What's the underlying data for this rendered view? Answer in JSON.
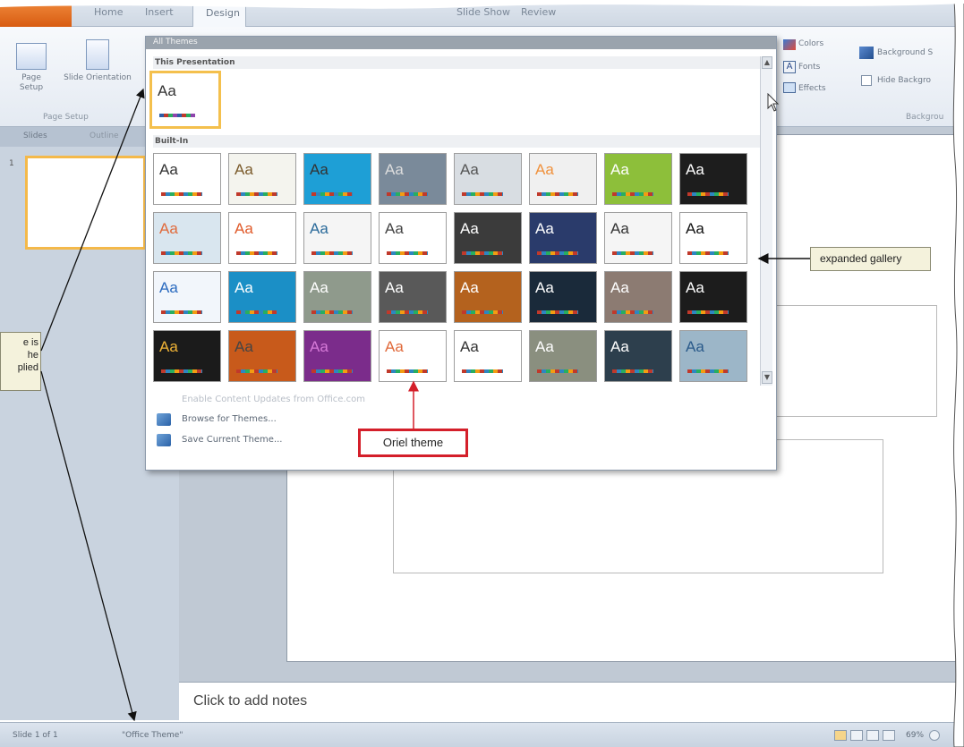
{
  "ribbon": {
    "tabs": [
      "Home",
      "Insert",
      "Design",
      "Slide Show",
      "Review"
    ],
    "page_setup_label": "Page Setup",
    "slide_orientation_label": "Slide Orientation",
    "group_page_setup": "Page Setup",
    "colors_label": "Colors",
    "fonts_label": "Fonts",
    "effects_label": "Effects",
    "background_styles_label": "Background S",
    "hide_background_label": "Hide Backgro",
    "group_background": "Backgrou"
  },
  "left_pane": {
    "tab_slides": "Slides",
    "tab_outline": "Outline",
    "slide_number": "1"
  },
  "gallery": {
    "header": "All Themes",
    "section_this_presentation": "This Presentation",
    "section_built_in": "Built-In",
    "current_theme_aa": "Aa",
    "theme_aa": "Aa",
    "theme_colors": [
      "#ffffff",
      "#f4f4ee",
      "#1e9fd6",
      "#7a8a9a",
      "#d8dde2",
      "#f0f0f0",
      "#8dbf3a",
      "#1d1d1d",
      "#d9e6ef",
      "#ffffff",
      "#f5f5f5",
      "#ffffff",
      "#3b3b3b",
      "#2a3b6b",
      "#f5f5f5",
      "#ffffff",
      "#f2f6fb",
      "#1b8fc6",
      "#8f9a8c",
      "#595959",
      "#b4621e",
      "#1a2a3a",
      "#8c7b72",
      "#1c1c1c",
      "#1b1b1b",
      "#c85a1b",
      "#7b2c8b",
      "#ffffff",
      "#ffffff",
      "#8a8f7f",
      "#2d3f4d",
      "#9cb6c8"
    ],
    "aa_colors": [
      "#333333",
      "#7a5a2a",
      "#333333",
      "#dddddd",
      "#555555",
      "#f0913c",
      "#ffffff",
      "#ffffff",
      "#e06a3b",
      "#e05a2a",
      "#2a6a9a",
      "#444444",
      "#ffffff",
      "#ffffff",
      "#333333",
      "#111111",
      "#2a6abf",
      "#ffffff",
      "#ffffff",
      "#ffffff",
      "#ffffff",
      "#ffffff",
      "#ffffff",
      "#ffffff",
      "#f0b437",
      "#444444",
      "#d67ad8",
      "#e06a3b",
      "#333333",
      "#ffffff",
      "#ffffff",
      "#2a5a8a"
    ],
    "menu_enable_updates": "Enable Content Updates from Office.com",
    "menu_browse": "Browse for Themes...",
    "menu_save": "Save Current Theme..."
  },
  "notes": {
    "placeholder": "Click to add notes"
  },
  "status": {
    "slide_info": "Slide 1 of 1",
    "theme_name": "\"Office Theme\"",
    "zoom": "69%"
  },
  "callouts": {
    "expanded_gallery": "expanded gallery",
    "oriel_theme": "Oriel theme",
    "left_partial_line1": "e is",
    "left_partial_line2": "he",
    "left_partial_line3": "plied"
  },
  "colors": {
    "callout_bg": "#f4f2dc",
    "oriel_border": "#d41f2a",
    "current_theme_border": "#f4c04d"
  }
}
